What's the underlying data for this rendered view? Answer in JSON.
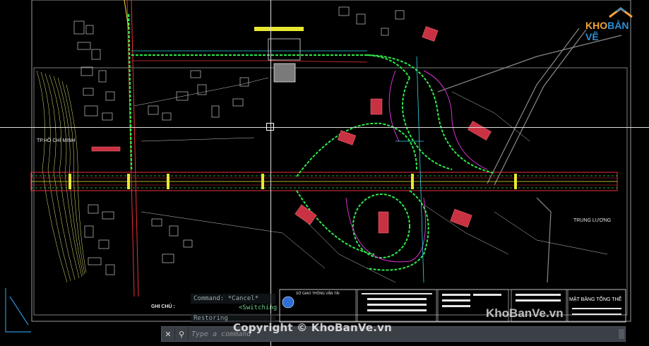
{
  "drawing": {
    "labels": {
      "left_city": "TP.HỒ CHÍ MINH",
      "right_city": "TRUNG LƯƠNG",
      "notes_heading": "GHI CHÚ :",
      "title_block": "MẶT BẰNG TỔNG THỂ",
      "org_name": "SỞ GIAO THÔNG VẬN TẢI"
    }
  },
  "command_line": {
    "history": [
      "Command: *Cancel*",
      "Restoring"
    ],
    "hint": "<Switching",
    "placeholder": "Type a command",
    "close_label": "✕",
    "customize_label": "⚲"
  },
  "watermark": {
    "copyright": "Copyright © KhoBanVe.vn",
    "site": "KhoBanVe.vn",
    "logo_kho": "KHO",
    "logo_banve": "BẢN VẼ"
  },
  "colors": {
    "road_red": "#e8323c",
    "road_green": "#2ee84a",
    "road_yellow": "#e8e832",
    "road_cyan": "#32d8e8",
    "road_magenta": "#d832d8",
    "building_red": "#c83242",
    "white": "#e6e6e6",
    "logo_orange": "#f2a33a",
    "logo_blue": "#2d8fd6"
  }
}
